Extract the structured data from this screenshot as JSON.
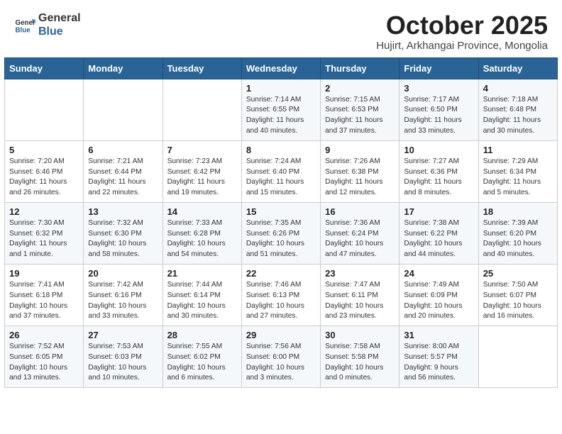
{
  "header": {
    "logo_line1": "General",
    "logo_line2": "Blue",
    "month_year": "October 2025",
    "location": "Hujirt, Arkhangai Province, Mongolia"
  },
  "days_of_week": [
    "Sunday",
    "Monday",
    "Tuesday",
    "Wednesday",
    "Thursday",
    "Friday",
    "Saturday"
  ],
  "weeks": [
    [
      {
        "day": "",
        "content": ""
      },
      {
        "day": "",
        "content": ""
      },
      {
        "day": "",
        "content": ""
      },
      {
        "day": "1",
        "content": "Sunrise: 7:14 AM\nSunset: 6:55 PM\nDaylight: 11 hours\nand 40 minutes."
      },
      {
        "day": "2",
        "content": "Sunrise: 7:15 AM\nSunset: 6:53 PM\nDaylight: 11 hours\nand 37 minutes."
      },
      {
        "day": "3",
        "content": "Sunrise: 7:17 AM\nSunset: 6:50 PM\nDaylight: 11 hours\nand 33 minutes."
      },
      {
        "day": "4",
        "content": "Sunrise: 7:18 AM\nSunset: 6:48 PM\nDaylight: 11 hours\nand 30 minutes."
      }
    ],
    [
      {
        "day": "5",
        "content": "Sunrise: 7:20 AM\nSunset: 6:46 PM\nDaylight: 11 hours\nand 26 minutes."
      },
      {
        "day": "6",
        "content": "Sunrise: 7:21 AM\nSunset: 6:44 PM\nDaylight: 11 hours\nand 22 minutes."
      },
      {
        "day": "7",
        "content": "Sunrise: 7:23 AM\nSunset: 6:42 PM\nDaylight: 11 hours\nand 19 minutes."
      },
      {
        "day": "8",
        "content": "Sunrise: 7:24 AM\nSunset: 6:40 PM\nDaylight: 11 hours\nand 15 minutes."
      },
      {
        "day": "9",
        "content": "Sunrise: 7:26 AM\nSunset: 6:38 PM\nDaylight: 11 hours\nand 12 minutes."
      },
      {
        "day": "10",
        "content": "Sunrise: 7:27 AM\nSunset: 6:36 PM\nDaylight: 11 hours\nand 8 minutes."
      },
      {
        "day": "11",
        "content": "Sunrise: 7:29 AM\nSunset: 6:34 PM\nDaylight: 11 hours\nand 5 minutes."
      }
    ],
    [
      {
        "day": "12",
        "content": "Sunrise: 7:30 AM\nSunset: 6:32 PM\nDaylight: 11 hours\nand 1 minute."
      },
      {
        "day": "13",
        "content": "Sunrise: 7:32 AM\nSunset: 6:30 PM\nDaylight: 10 hours\nand 58 minutes."
      },
      {
        "day": "14",
        "content": "Sunrise: 7:33 AM\nSunset: 6:28 PM\nDaylight: 10 hours\nand 54 minutes."
      },
      {
        "day": "15",
        "content": "Sunrise: 7:35 AM\nSunset: 6:26 PM\nDaylight: 10 hours\nand 51 minutes."
      },
      {
        "day": "16",
        "content": "Sunrise: 7:36 AM\nSunset: 6:24 PM\nDaylight: 10 hours\nand 47 minutes."
      },
      {
        "day": "17",
        "content": "Sunrise: 7:38 AM\nSunset: 6:22 PM\nDaylight: 10 hours\nand 44 minutes."
      },
      {
        "day": "18",
        "content": "Sunrise: 7:39 AM\nSunset: 6:20 PM\nDaylight: 10 hours\nand 40 minutes."
      }
    ],
    [
      {
        "day": "19",
        "content": "Sunrise: 7:41 AM\nSunset: 6:18 PM\nDaylight: 10 hours\nand 37 minutes."
      },
      {
        "day": "20",
        "content": "Sunrise: 7:42 AM\nSunset: 6:16 PM\nDaylight: 10 hours\nand 33 minutes."
      },
      {
        "day": "21",
        "content": "Sunrise: 7:44 AM\nSunset: 6:14 PM\nDaylight: 10 hours\nand 30 minutes."
      },
      {
        "day": "22",
        "content": "Sunrise: 7:46 AM\nSunset: 6:13 PM\nDaylight: 10 hours\nand 27 minutes."
      },
      {
        "day": "23",
        "content": "Sunrise: 7:47 AM\nSunset: 6:11 PM\nDaylight: 10 hours\nand 23 minutes."
      },
      {
        "day": "24",
        "content": "Sunrise: 7:49 AM\nSunset: 6:09 PM\nDaylight: 10 hours\nand 20 minutes."
      },
      {
        "day": "25",
        "content": "Sunrise: 7:50 AM\nSunset: 6:07 PM\nDaylight: 10 hours\nand 16 minutes."
      }
    ],
    [
      {
        "day": "26",
        "content": "Sunrise: 7:52 AM\nSunset: 6:05 PM\nDaylight: 10 hours\nand 13 minutes."
      },
      {
        "day": "27",
        "content": "Sunrise: 7:53 AM\nSunset: 6:03 PM\nDaylight: 10 hours\nand 10 minutes."
      },
      {
        "day": "28",
        "content": "Sunrise: 7:55 AM\nSunset: 6:02 PM\nDaylight: 10 hours\nand 6 minutes."
      },
      {
        "day": "29",
        "content": "Sunrise: 7:56 AM\nSunset: 6:00 PM\nDaylight: 10 hours\nand 3 minutes."
      },
      {
        "day": "30",
        "content": "Sunrise: 7:58 AM\nSunset: 5:58 PM\nDaylight: 10 hours\nand 0 minutes."
      },
      {
        "day": "31",
        "content": "Sunrise: 8:00 AM\nSunset: 5:57 PM\nDaylight: 9 hours\nand 56 minutes."
      },
      {
        "day": "",
        "content": ""
      }
    ]
  ]
}
